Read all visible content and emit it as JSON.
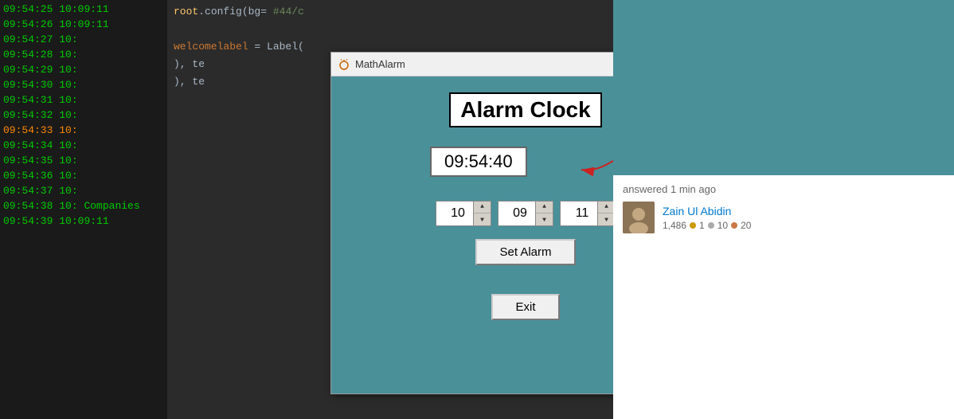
{
  "terminal": {
    "lines": [
      {
        "time1": "09:54:25",
        "time2": "10:09:11",
        "rest": ""
      },
      {
        "time1": "09:54:26",
        "time2": "10:09:11",
        "rest": ""
      },
      {
        "time1": "09:54:27",
        "time2": "10:",
        "rest": ""
      },
      {
        "time1": "09:54:28",
        "time2": "10:",
        "rest": ""
      },
      {
        "time1": "09:54:29",
        "time2": "10:",
        "rest": ""
      },
      {
        "time1": "09:54:30",
        "time2": "10:",
        "rest": ""
      },
      {
        "time1": "09:54:31",
        "time2": "10:",
        "rest": ""
      },
      {
        "time1": "09:54:32",
        "time2": "10:",
        "rest": ""
      },
      {
        "time1": "09:54:33",
        "time2": "10:",
        "rest": ""
      },
      {
        "time1": "09:54:34",
        "time2": "10:",
        "rest": ""
      },
      {
        "time1": "09:54:35",
        "time2": "10:",
        "rest": ""
      },
      {
        "time1": "09:54:36",
        "time2": "10:",
        "rest": ""
      },
      {
        "time1": "09:54:37",
        "time2": "10:",
        "rest": ""
      },
      {
        "time1": "09:54:38",
        "time2": "10:",
        "rest": ""
      },
      {
        "time1": "09:54:39",
        "time2": "10:09:11",
        "rest": ""
      }
    ]
  },
  "code": {
    "line1": "root.config(bg= #44/c",
    "line2": "",
    "line3": "welcomelabel = Label(",
    "line4": "), te",
    "line5": "), te"
  },
  "alarm_window": {
    "title": "MathAlarm",
    "heading": "Alarm Clock",
    "current_time": "09:54:40",
    "spinner_hour": "10",
    "spinner_minute": "09",
    "spinner_second": "11",
    "set_alarm_label": "Set Alarm",
    "exit_label": "Exit",
    "minimize_label": "—",
    "maximize_label": "□",
    "close_label": "✕"
  },
  "right_panel": {
    "answered_text": "answered 1 min ago",
    "username": "Zain Ul Abidin",
    "reputation": "1,486",
    "gold_badges": "1",
    "silver_badges": "10",
    "bronze_badges": "20"
  }
}
